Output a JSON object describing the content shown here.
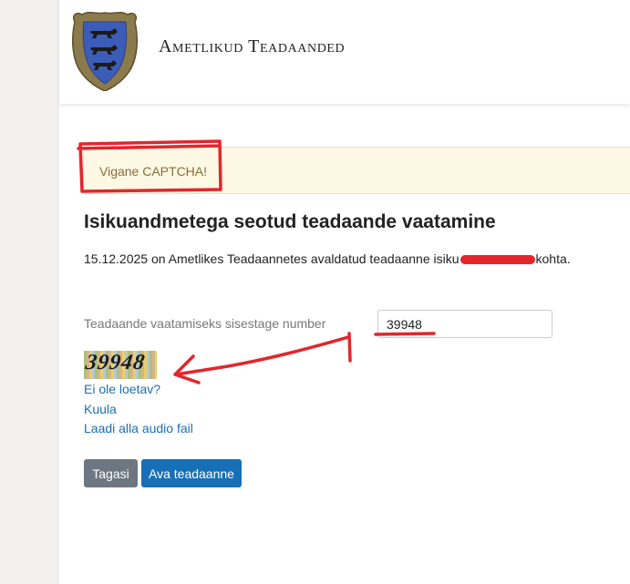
{
  "header": {
    "title": "Ametlikud Teadaanded",
    "logo_icon": "estonia-coat-of-arms-icon"
  },
  "alert": {
    "message": "Vigane CAPTCHA!"
  },
  "main": {
    "title": "Isikuandmetega seotud teadaande vaatamine",
    "intro_before": "15.12.2025 on Ametlikes Teadaannetes avaldatud teadaanne isiku",
    "intro_after": "kohta.",
    "field_label": "Teadaande vaatamiseks sisestage number",
    "number_value": "39948"
  },
  "captcha": {
    "image_text": "39948",
    "unreadable_link": "Ei ole loetav?",
    "listen_link": "Kuula",
    "download_link": "Laadi alla audio fail"
  },
  "buttons": {
    "back_label": "Tagasi",
    "view_label": "Ava teadaanne"
  },
  "colors": {
    "alert_background": "#fcf8e3",
    "alert_text": "#8a6d3b",
    "link": "#1d6fb3",
    "primary_button": "#1770b6",
    "secondary_button": "#6d7781",
    "annotation": "#e3262c"
  }
}
